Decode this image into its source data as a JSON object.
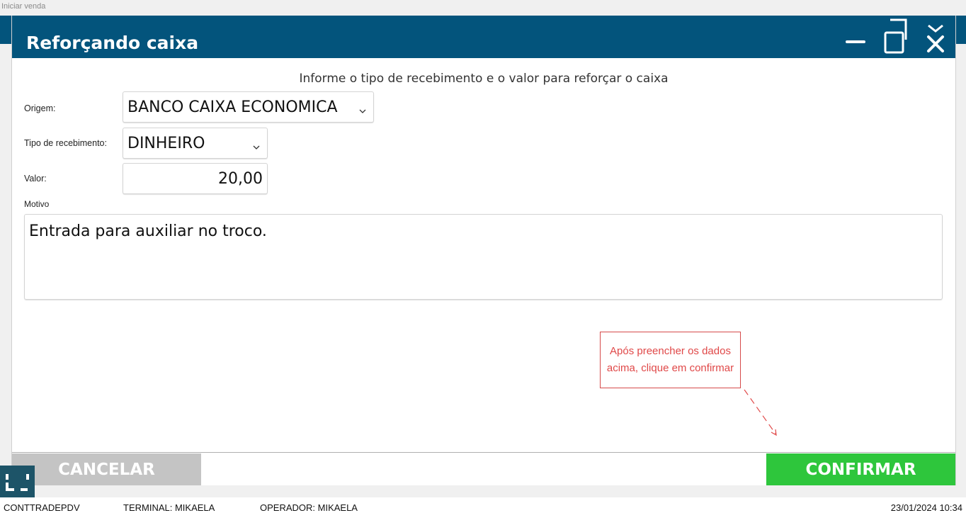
{
  "top_caption": "Iniciar venda",
  "dialog": {
    "title": "Reforçando caixa",
    "subtitle": "Informe o tipo de recebimento e o valor para reforçar o caixa",
    "controls": [
      "minimize-icon",
      "restore-icon",
      "close-icon"
    ]
  },
  "form": {
    "origem_label": "Origem:",
    "origem_value": "BANCO CAIXA ECONOMICA",
    "tipo_label": "Tipo de recebimento:",
    "tipo_value": "DINHEIRO",
    "valor_label": "Valor:",
    "valor_value": "20,00",
    "motivo_label": "Motivo",
    "motivo_value": "Entrada para auxiliar no troco."
  },
  "annotation": {
    "text": "Após preencher os dados\nacima, clique em confirmar",
    "color": "#e04848"
  },
  "buttons": {
    "cancel": "CANCELAR",
    "confirm": "CONFIRMAR"
  },
  "status_bar": {
    "app": "CONTTRADEPDV",
    "terminal": "TERMINAL: MIKAELA",
    "operator": "OPERADOR: MIKAELA",
    "datetime": "23/01/2024 10:34"
  },
  "colors": {
    "title_bar": "#03547c",
    "confirm": "#2ec63c",
    "cancel": "#c4c4c4"
  }
}
